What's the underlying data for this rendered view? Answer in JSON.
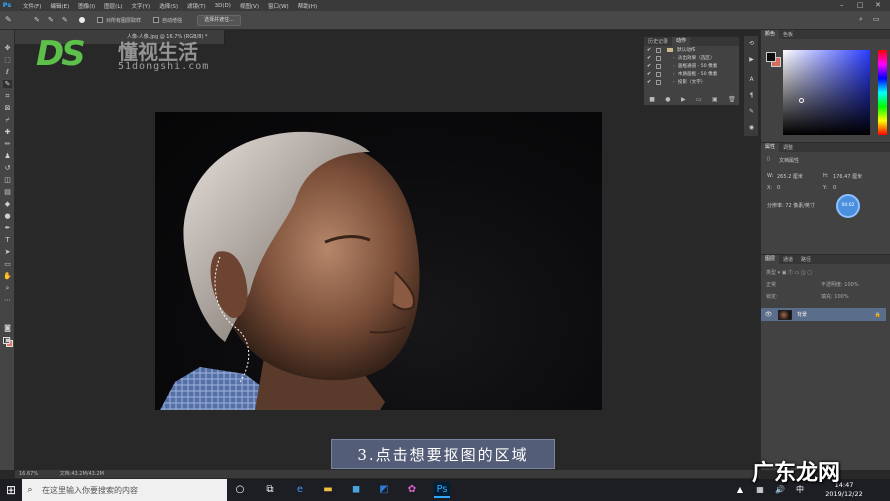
{
  "app": {
    "logo": "Ps"
  },
  "menu": [
    "文件(F)",
    "编辑(E)",
    "图像(I)",
    "图层(L)",
    "文字(Y)",
    "选择(S)",
    "滤镜(T)",
    "3D(D)",
    "视图(V)",
    "窗口(W)",
    "帮助(H)"
  ],
  "options": {
    "sample_all_layers": "对所有图层取样",
    "auto_enhance": "自动增强",
    "select_subject": "选择并遮住..."
  },
  "document": {
    "tab_title": "人像-人像.jpg @ 16.7% (RGB/8) *",
    "zoom": "16.67%",
    "status": "文档:43.2M/43.2M"
  },
  "watermark": {
    "logo": "DS",
    "name": "懂视生活",
    "url": "51dongshi.com"
  },
  "history_panel": {
    "tabs": [
      "历史记录",
      "动作"
    ],
    "rows": [
      "默认动作",
      "淡出效果（选区）",
      "画框通道 - 50 像素",
      "木质画框 - 50 像素",
      "投影（文字）"
    ]
  },
  "color_panel": {
    "tabs": [
      "颜色",
      "色板"
    ],
    "fg": "#0e0e0e",
    "bg": "#d66c5f"
  },
  "properties_panel": {
    "tabs": [
      "属性",
      "调整"
    ],
    "title": "文档属性",
    "w_label": "W:",
    "w_value": "265.2 厘米",
    "h_label": "H:",
    "h_value": "176.47 厘米",
    "x_label": "X:",
    "x_value": "0",
    "y_label": "Y:",
    "y_value": "0",
    "resolution": "分辨率: 72 像素/英寸",
    "badge": "00:02"
  },
  "layers_panel": {
    "tabs": [
      "图层",
      "通道",
      "路径"
    ],
    "kind": "类型",
    "blend": "正常",
    "opacity": "不透明度: 100%",
    "lock": "锁定:",
    "fill": "填充: 100%",
    "layer_name": "背景"
  },
  "caption": "3.点击想要抠图的区域",
  "taskbar": {
    "search_placeholder": "在这里输入你要搜索的内容",
    "time": "14:47",
    "date": "2019/12/22"
  },
  "site_watermark": "广东龙网"
}
